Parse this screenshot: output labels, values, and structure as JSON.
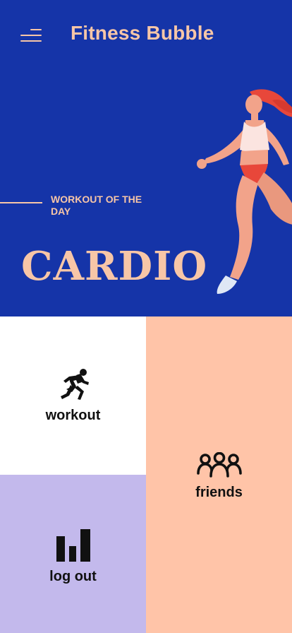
{
  "header": {
    "menu_icon": "hamburger-menu-icon",
    "title": "Fitness Bubble"
  },
  "hero": {
    "label": "WORKOUT OF THE DAY",
    "title": "CARDIO"
  },
  "tiles": {
    "workout": {
      "label": "workout",
      "icon": "running-person-icon"
    },
    "friends": {
      "label": "friends",
      "icon": "group-people-icon"
    },
    "logout": {
      "label": "log out",
      "icon": "bar-chart-icon"
    }
  },
  "colors": {
    "primary": "#1534a8",
    "accent": "#f7c6a7",
    "friends_tile": "#ffc4a8",
    "logout_tile": "#c3b9ec",
    "workout_tile": "#ffffff"
  }
}
